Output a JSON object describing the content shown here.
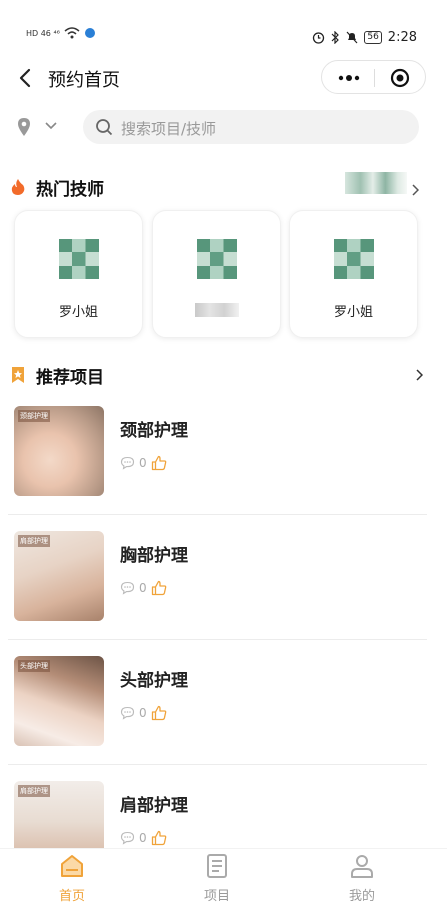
{
  "status_bar": {
    "left": "HD 46 ⁴⁶",
    "battery": "56",
    "time": "2:28"
  },
  "nav": {
    "title": "预约首页"
  },
  "search": {
    "placeholder": "搜索项目/技师"
  },
  "hot_techs": {
    "title": "热门技师",
    "items": [
      {
        "name": "罗小姐"
      },
      {
        "name": ""
      },
      {
        "name": "罗小姐"
      }
    ]
  },
  "recommended": {
    "title": "推荐项目",
    "items": [
      {
        "name": "颈部护理",
        "tag": "颈部护理",
        "comments": "0"
      },
      {
        "name": "胸部护理",
        "tag": "肩部护理",
        "comments": "0"
      },
      {
        "name": "头部护理",
        "tag": "头部护理",
        "comments": "0"
      },
      {
        "name": "肩部护理",
        "tag": "肩部护理",
        "comments": "0"
      }
    ]
  },
  "tabbar": {
    "items": [
      {
        "label": "首页"
      },
      {
        "label": "项目"
      },
      {
        "label": "我的"
      }
    ]
  },
  "colors": {
    "accent": "#f0a33a",
    "fire": "#f26b2a",
    "text": "#222222"
  }
}
